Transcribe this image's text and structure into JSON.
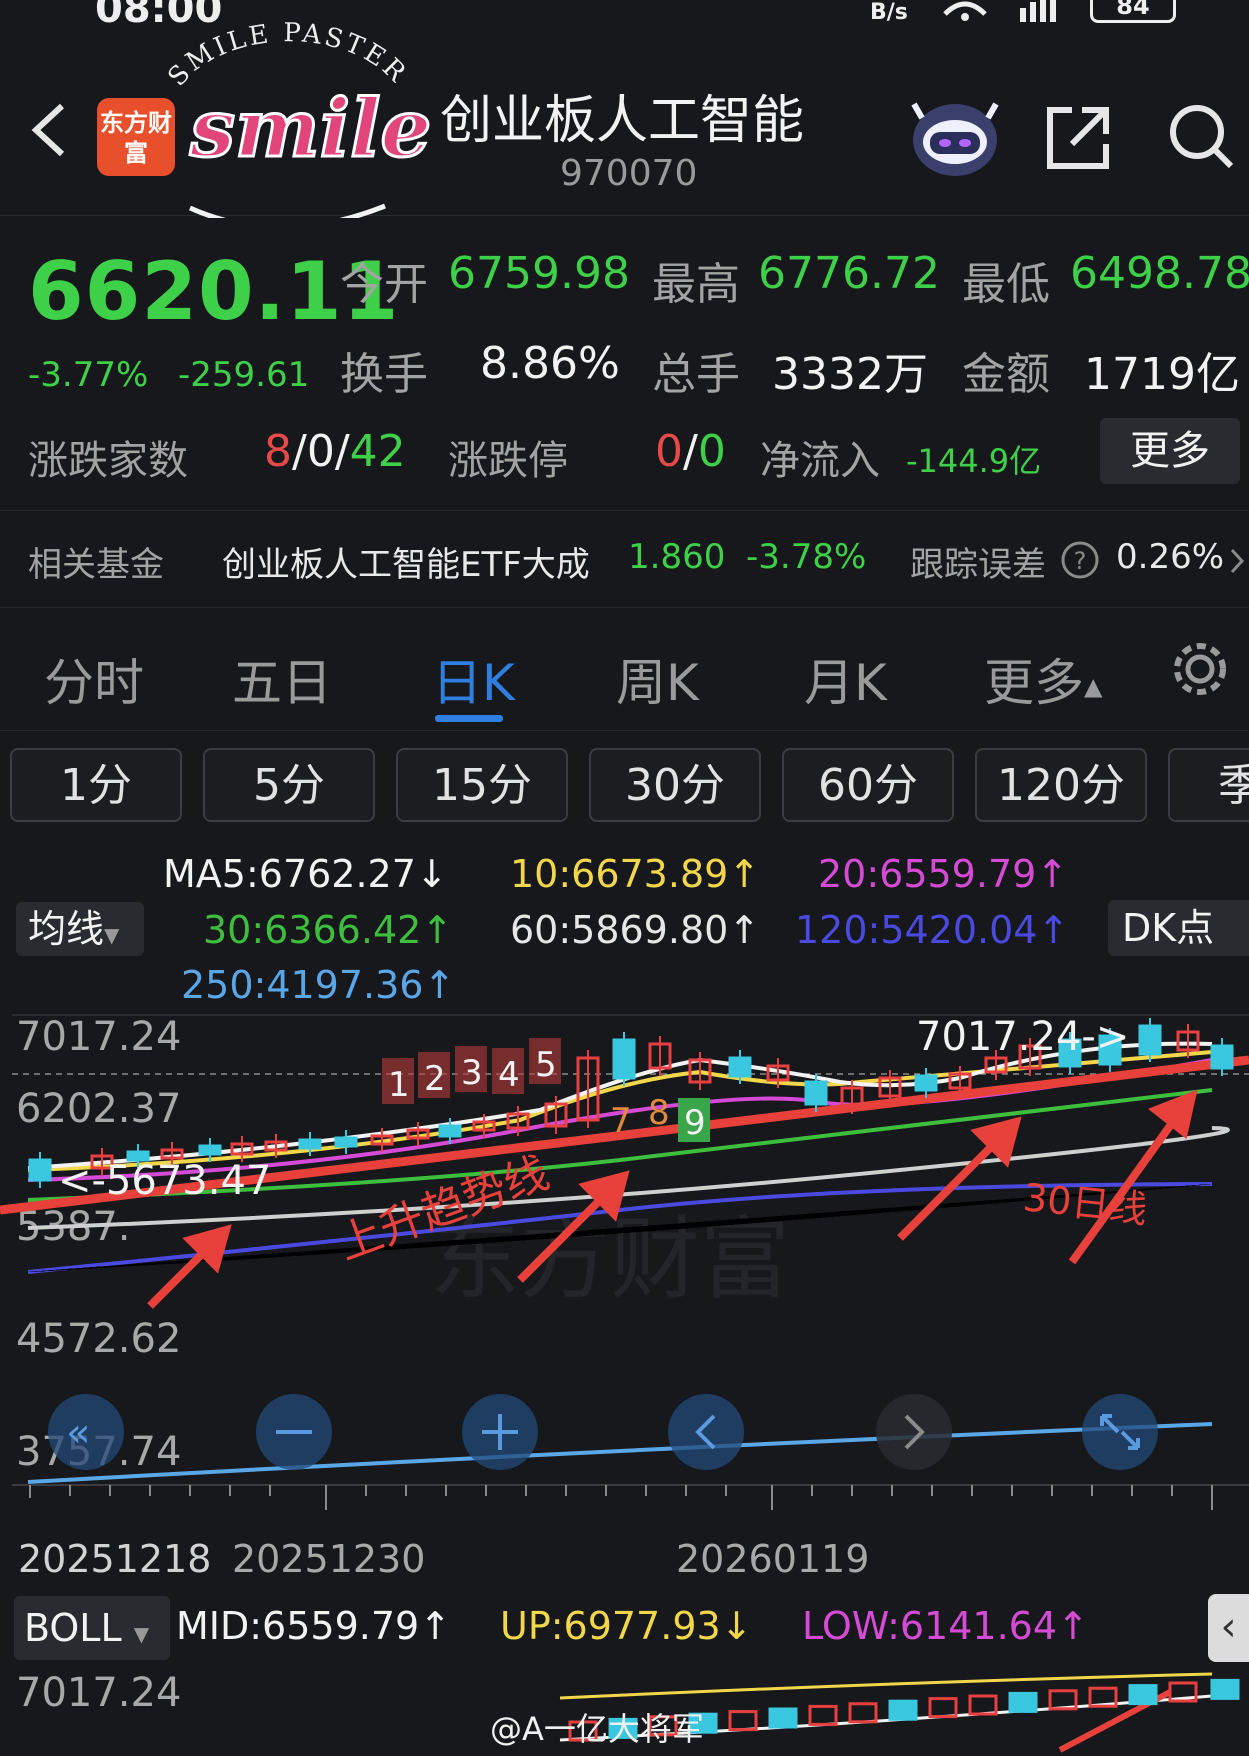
{
  "status": {
    "time": "08:00",
    "net_speed": "B/s",
    "battery": "84"
  },
  "header": {
    "app_logo": "东方财富",
    "sticker_text": "SMILE PASTER",
    "sticker_word": "smile",
    "title": "创业板人工智能",
    "code": "970070"
  },
  "quote": {
    "price": "6620.11",
    "change_pct": "-3.77%",
    "change_abs": "-259.61",
    "open_label": "今开",
    "open": "6759.98",
    "high_label": "最高",
    "high": "6776.72",
    "low_label": "最低",
    "low": "6498.78",
    "turnover_label": "换手",
    "turnover": "8.86%",
    "volume_label": "总手",
    "volume": "3332万",
    "amount_label": "金额",
    "amount": "1719亿"
  },
  "breadth": {
    "label": "涨跌家数",
    "up": "8",
    "sep1": "/",
    "flat": "0",
    "sep2": "/",
    "down": "42",
    "limit_label": "涨跌停",
    "limit_up": "0",
    "limit_sep": "/",
    "limit_down": "0",
    "inflow_label": "净流入",
    "inflow": "-144.9亿",
    "more": "更多"
  },
  "fund": {
    "label": "相关基金",
    "name": "创业板人工智能ETF大成",
    "price": "1.860",
    "change": "-3.78%",
    "error_label": "跟踪误差",
    "error": "0.26%"
  },
  "tabs": [
    "分时",
    "五日",
    "日K",
    "周K",
    "月K",
    "更多"
  ],
  "intervals": [
    "1分",
    "5分",
    "15分",
    "30分",
    "60分",
    "120分",
    "季"
  ],
  "ma": {
    "dropdown": "均线",
    "ma5": "MA5:6762.27↓",
    "ma10": "10:6673.89↑",
    "ma20": "20:6559.79↑",
    "ma30": "30:6366.42↑",
    "ma60": "60:5869.80↑",
    "ma120": "120:5420.04↑",
    "ma250": "250:4197.36↑",
    "dk": "DK点",
    "colors": {
      "ma5": "#f2f2f2",
      "ma10": "#f2d74a",
      "ma20": "#d64bd6",
      "ma30": "#3dbf3d",
      "ma60": "#cfcfcf",
      "ma120": "#4a4ae0",
      "ma250": "#5aa7e8"
    }
  },
  "kchart": {
    "y_labels": [
      "7017.24",
      "6202.37",
      "5387.",
      "4572.62",
      "3757.74"
    ],
    "high_marker": "7017.24->",
    "low_marker": "<-5673.47",
    "date_labels": [
      "20251218",
      "20251230",
      "20260119"
    ],
    "td_up": [
      "1",
      "2",
      "3",
      "4",
      "5"
    ],
    "td_down": [
      "7",
      "8",
      "9"
    ],
    "annotation_trend": "上升趋势线",
    "annotation_ma30": "30日线",
    "watermark": "东方财富"
  },
  "boll": {
    "dropdown": "BOLL",
    "mid": "MID:6559.79↑",
    "up": "UP:6977.93↓",
    "low": "LOW:6141.64↑",
    "y_label": "7017.24",
    "collapse": "‹"
  },
  "footer": {
    "watermark": "@A一亿大将军"
  }
}
